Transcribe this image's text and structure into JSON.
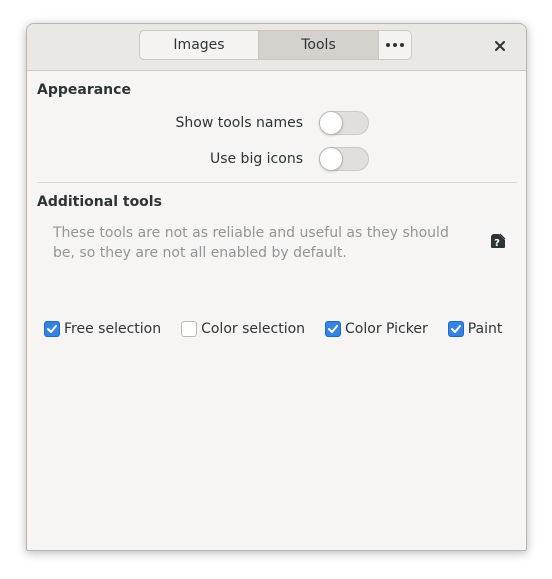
{
  "header": {
    "tabs": [
      {
        "label": "Images",
        "active": false
      },
      {
        "label": "Tools",
        "active": true
      }
    ],
    "menu_icon": "more-horizontal-icon",
    "close_icon": "close-icon"
  },
  "appearance": {
    "title": "Appearance",
    "rows": [
      {
        "label": "Show tools names",
        "on": false
      },
      {
        "label": "Use big icons",
        "on": false
      }
    ]
  },
  "additional": {
    "title": "Additional tools",
    "description": "These tools are not as reliable and useful as they should be, so they are not all enabled by default.",
    "help_icon": "help-icon",
    "tools": [
      {
        "label": "Free selection",
        "checked": true
      },
      {
        "label": "Color selection",
        "checked": false
      },
      {
        "label": "Color Picker",
        "checked": true
      },
      {
        "label": "Paint",
        "checked": true
      }
    ]
  },
  "colors": {
    "accent": "#3584e4",
    "window_bg": "#f6f5f4",
    "headerbar_bg": "#eae8e5"
  }
}
